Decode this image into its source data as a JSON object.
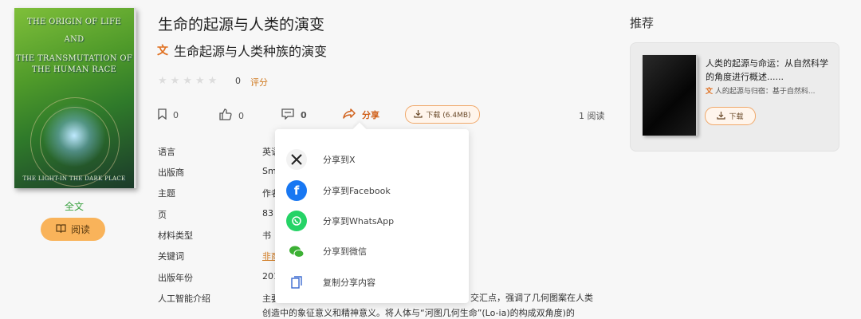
{
  "book": {
    "cover": {
      "line1": "THE ORIGIN OF LIFE",
      "line2": "AND",
      "line3": "THE TRANSMUTATION OF",
      "line4": "THE HUMAN RACE",
      "bottom": "THE LIGHT-IN THE DARK PLACE"
    },
    "fulltext_label": "全文",
    "read_button": "阅读",
    "title": "生命的起源与人类的演变",
    "translated_title": "生命起源与人类种族的演变",
    "rating_count": "0",
    "rating_link": "评分",
    "actions": {
      "bookmark_count": "0",
      "like_count": "0",
      "comment_count": "0",
      "share_label": "分享",
      "download_label": "下载 (6.4MB)",
      "reads": "1 阅读"
    },
    "details": [
      {
        "label": "语言",
        "value": "英语"
      },
      {
        "label": "出版商",
        "value": "Sm"
      },
      {
        "label": "主题",
        "value": "作者"
      },
      {
        "label": "页",
        "value": "83"
      },
      {
        "label": "材料类型",
        "value": "书"
      },
      {
        "label": "关键词",
        "value": "非商"
      },
      {
        "label": "出版年份",
        "value": "201"
      },
      {
        "label": "人工智能介绍",
        "value": "主要"
      }
    ],
    "ai_desc_tail": "交汇点，强调了几何图案在人类",
    "ai_desc_line2": "创造中的象征意义和精神意义。将人体与“河图几何生命”(Lo-ia)的构成双角度)的"
  },
  "share_menu": {
    "items": [
      {
        "label": "分享到X",
        "icon": "x-icon"
      },
      {
        "label": "分享到Facebook",
        "icon": "facebook-icon"
      },
      {
        "label": "分享到WhatsApp",
        "icon": "whatsapp-icon"
      },
      {
        "label": "分享到微信",
        "icon": "wechat-icon"
      },
      {
        "label": "复制分享内容",
        "icon": "copy-icon"
      }
    ]
  },
  "recommend": {
    "heading": "推荐",
    "item": {
      "title": "人类的起源与命运：从自然科学的角度进行概述......",
      "subtitle": "人的起源与归宿：基于自然科...",
      "download": "下载"
    }
  },
  "colors": {
    "accent": "#d0601a",
    "read_button": "#f9b35a",
    "fulltext": "#3aa140"
  }
}
